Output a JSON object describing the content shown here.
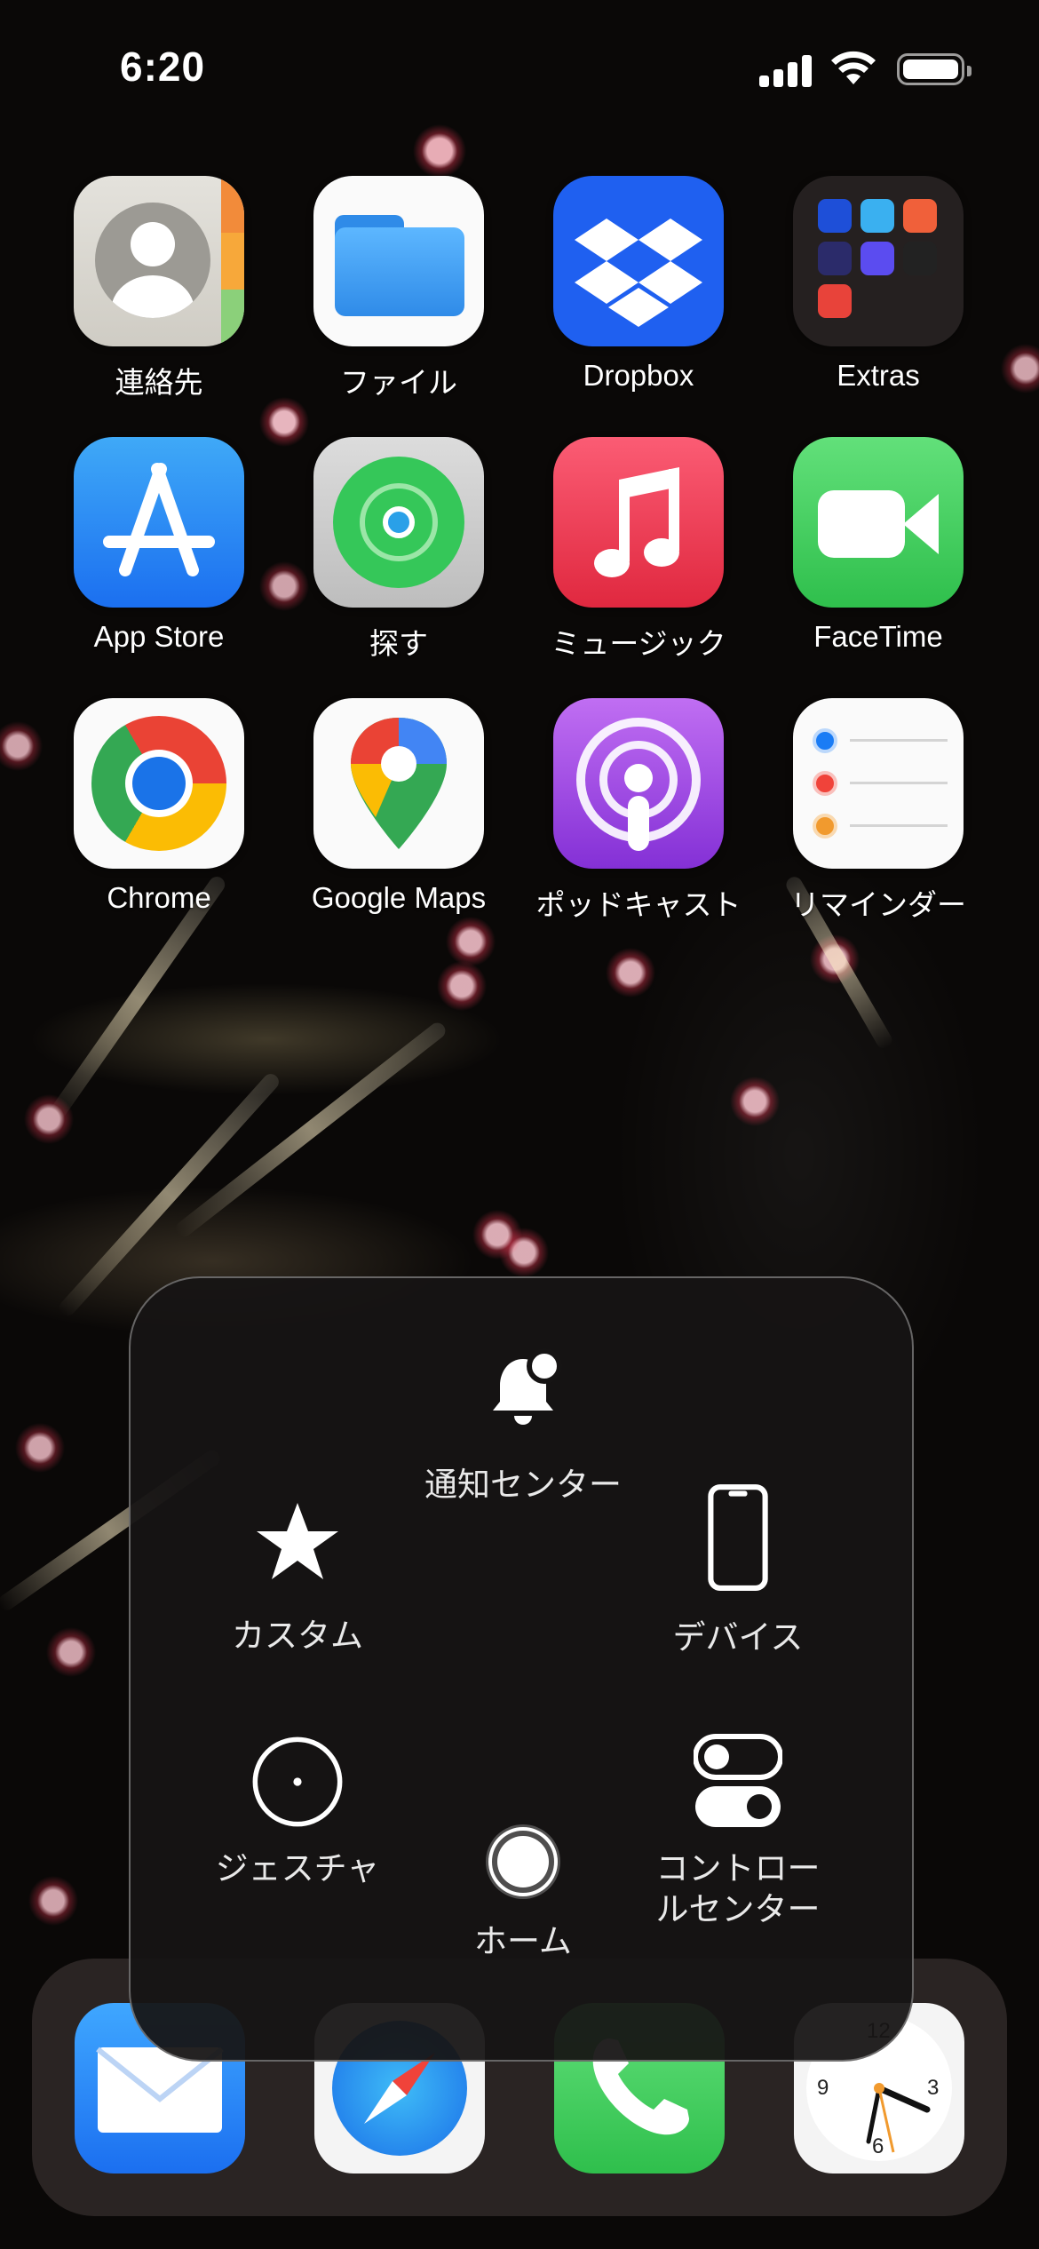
{
  "status_bar": {
    "time": "6:20"
  },
  "apps": [
    {
      "name": "連絡先"
    },
    {
      "name": "ファイル"
    },
    {
      "name": "Dropbox"
    },
    {
      "name": "Extras"
    },
    {
      "name": "App Store"
    },
    {
      "name": "探す"
    },
    {
      "name": "ミュージック"
    },
    {
      "name": "FaceTime"
    },
    {
      "name": "Chrome"
    },
    {
      "name": "Google Maps"
    },
    {
      "name": "ポッドキャスト"
    },
    {
      "name": "リマインダー"
    }
  ],
  "dock": {
    "apps": [
      "mail-icon",
      "safari-icon",
      "phone-icon",
      "clock-icon"
    ]
  },
  "assistive_menu": {
    "notification_center": "通知センター",
    "custom": "カスタム",
    "device": "デバイス",
    "gesture": "ジェスチャ",
    "home": "ホーム",
    "control_center_line1": "コントロー",
    "control_center_line2": "ルセンター"
  },
  "clock_numbers": {
    "twelve": "12",
    "three": "3",
    "six": "6",
    "nine": "9"
  }
}
